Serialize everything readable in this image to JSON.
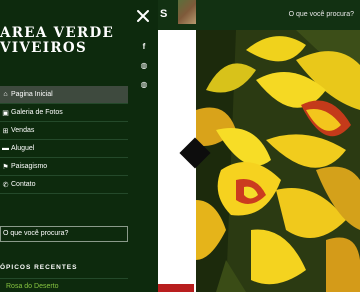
{
  "brand": {
    "line1": "AREA VERDE",
    "line2": "VIVEIROS"
  },
  "header": {
    "partial_title": "S",
    "search_label": "O que você procura?"
  },
  "nav": {
    "items": [
      {
        "label": "Pagina Inicial",
        "icon": "home-icon",
        "glyph": "⌂",
        "active": true
      },
      {
        "label": "Galeria de Fotos",
        "icon": "video-icon",
        "glyph": "▣",
        "active": false
      },
      {
        "label": "Vendas",
        "icon": "shopping-cart-icon",
        "glyph": "⊞",
        "active": false
      },
      {
        "label": "Aluguel",
        "icon": "truck-icon",
        "glyph": "▬",
        "active": false
      },
      {
        "label": "Paisagismo",
        "icon": "flag-icon",
        "glyph": "⚑",
        "active": false
      },
      {
        "label": "Contato",
        "icon": "phone-icon",
        "glyph": "✆",
        "active": false
      }
    ]
  },
  "social": {
    "facebook": "f",
    "globe": "◍"
  },
  "search": {
    "label": "O que você procura?"
  },
  "recent": {
    "title": "ÓPICOS RECENTES",
    "items": [
      "Rosa do Deserto"
    ]
  },
  "colors": {
    "menu_bg": "#0d2a0d",
    "active_bg": "#3e4a3e",
    "link_green": "#86c440",
    "header_bg": "#123112"
  }
}
